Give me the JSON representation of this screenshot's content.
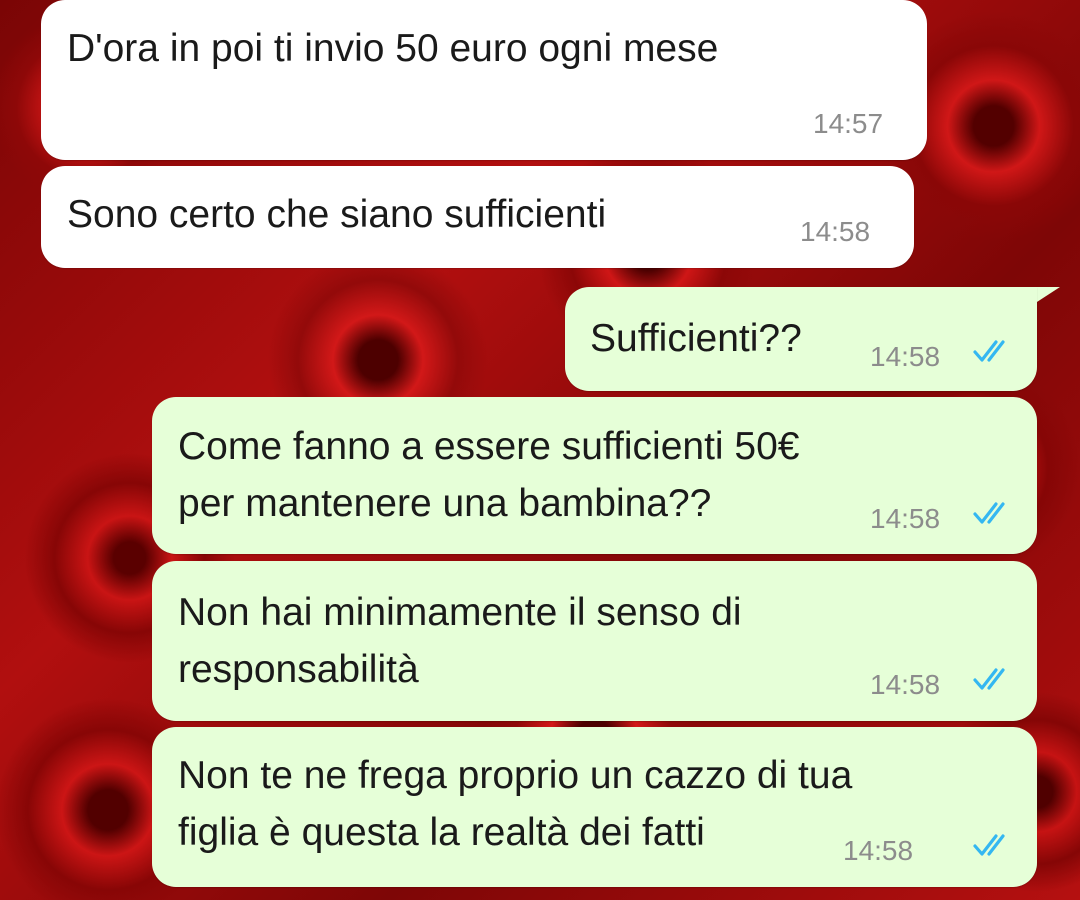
{
  "messages": [
    {
      "direction": "incoming",
      "lines": [
        "D'ora in poi ti invio 50 euro ogni mese"
      ],
      "time": "14:57"
    },
    {
      "direction": "incoming",
      "lines": [
        "Sono certo che siano sufficienti"
      ],
      "time": "14:58"
    },
    {
      "direction": "outgoing",
      "lines": [
        "Sufficienti??"
      ],
      "time": "14:58",
      "read": true
    },
    {
      "direction": "outgoing",
      "lines": [
        "Come fanno a essere sufficienti 50€",
        "per mantenere una bambina??"
      ],
      "time": "14:58",
      "read": true
    },
    {
      "direction": "outgoing",
      "lines": [
        "Non hai minimamente il senso di",
        "responsabilità"
      ],
      "time": "14:58",
      "read": true
    },
    {
      "direction": "outgoing",
      "lines": [
        "Non te ne frega proprio un cazzo di tua",
        "figlia è questa la realtà dei fatti"
      ],
      "time": "14:58",
      "read": true
    }
  ],
  "icons": {
    "read_receipt": "double-check-icon",
    "read_color": "#34b7f1"
  },
  "colors": {
    "incoming_bubble": "#ffffff",
    "outgoing_bubble": "#e6ffd8"
  }
}
